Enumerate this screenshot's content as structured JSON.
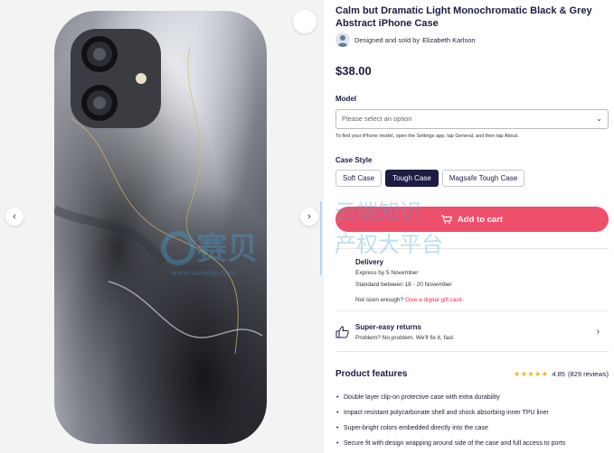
{
  "product": {
    "title": "Calm but Dramatic Light Monochromatic Black & Grey Abstract iPhone Case",
    "designer_prefix": "Designed and sold by",
    "designer_name": "Elizabeth Karlson",
    "price": "$38.00"
  },
  "gallery": {
    "prev_icon": "chevron-left-icon",
    "next_icon": "chevron-right-icon",
    "favorite_icon": "heart-icon"
  },
  "model": {
    "label": "Model",
    "placeholder": "Please select an option",
    "hint": "To find your iPhone model, open the Settings app, tap General, and then tap About."
  },
  "case_style": {
    "label": "Case Style",
    "options": [
      "Soft Case",
      "Tough Case",
      "Magsafe Tough Case"
    ],
    "selected": "Tough Case"
  },
  "cart": {
    "label": "Add to cart",
    "icon": "cart-plus-icon",
    "color": "#ee4f6b"
  },
  "delivery": {
    "title": "Delivery",
    "express": "Express by 5 November",
    "standard": "Standard between 18 - 20 November",
    "not_soon_prefix": "Not soon enough?",
    "gift_link": "Give a digital gift card."
  },
  "returns": {
    "title": "Super-easy returns",
    "subtitle": "Problem? No problem. We'll fix it, fast."
  },
  "features": {
    "title": "Product features",
    "rating_value": "4.85",
    "rating_reviews": "(829 reviews)",
    "stars": 5,
    "items": [
      "Double layer clip-on protective case with extra durability",
      "Impact resistant polycarbonate shell and shock absorbing inner TPU liner",
      "Super-bright colors embedded directly into the case",
      "Secure fit with design wrapping around side of the case and full access to ports"
    ]
  },
  "watermark": {
    "text_a": "赛贝",
    "text_b": "云端知识",
    "text_c": "产权大平台",
    "url": "www.saibeiip.com"
  },
  "colors": {
    "navy": "#1c1c44",
    "accent": "#ee4f6b",
    "star": "#f2b21a"
  }
}
